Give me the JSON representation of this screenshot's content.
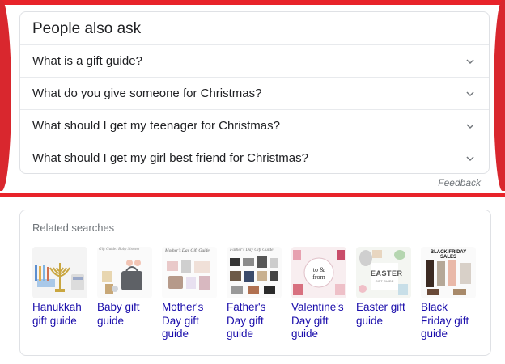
{
  "paa": {
    "title": "People also ask",
    "questions": [
      "What is a gift guide?",
      "What do you give someone for Christmas?",
      "What should I get my teenager for Christmas?",
      "What should I get my girl best friend for Christmas?"
    ],
    "feedback": "Feedback"
  },
  "related": {
    "title": "Related searches",
    "items": [
      {
        "label": "Hanukkah gift guide"
      },
      {
        "label": "Baby gift guide",
        "thumb_text": "Gift Guide: Baby Shower"
      },
      {
        "label": "Mother's Day gift guide",
        "thumb_text": "Mother's Day Gift Guide"
      },
      {
        "label": "Father's Day gift guide",
        "thumb_text": "Father's Day Gift Guide"
      },
      {
        "label": "Valentine's Day gift guide",
        "thumb_text": "to & from"
      },
      {
        "label": "Easter gift guide",
        "thumb_text": "EASTER",
        "thumb_subtext": "GIFT GUIDE"
      },
      {
        "label": "Black Friday gift guide",
        "thumb_text": "BLACK FRIDAY SALES"
      }
    ]
  },
  "colors": {
    "highlight": "#e8232a",
    "link": "#1a0dab",
    "text": "#202124",
    "muted": "#70757a",
    "border": "#dfe1e5"
  },
  "icons": {
    "expand": "chevron-down-icon"
  }
}
